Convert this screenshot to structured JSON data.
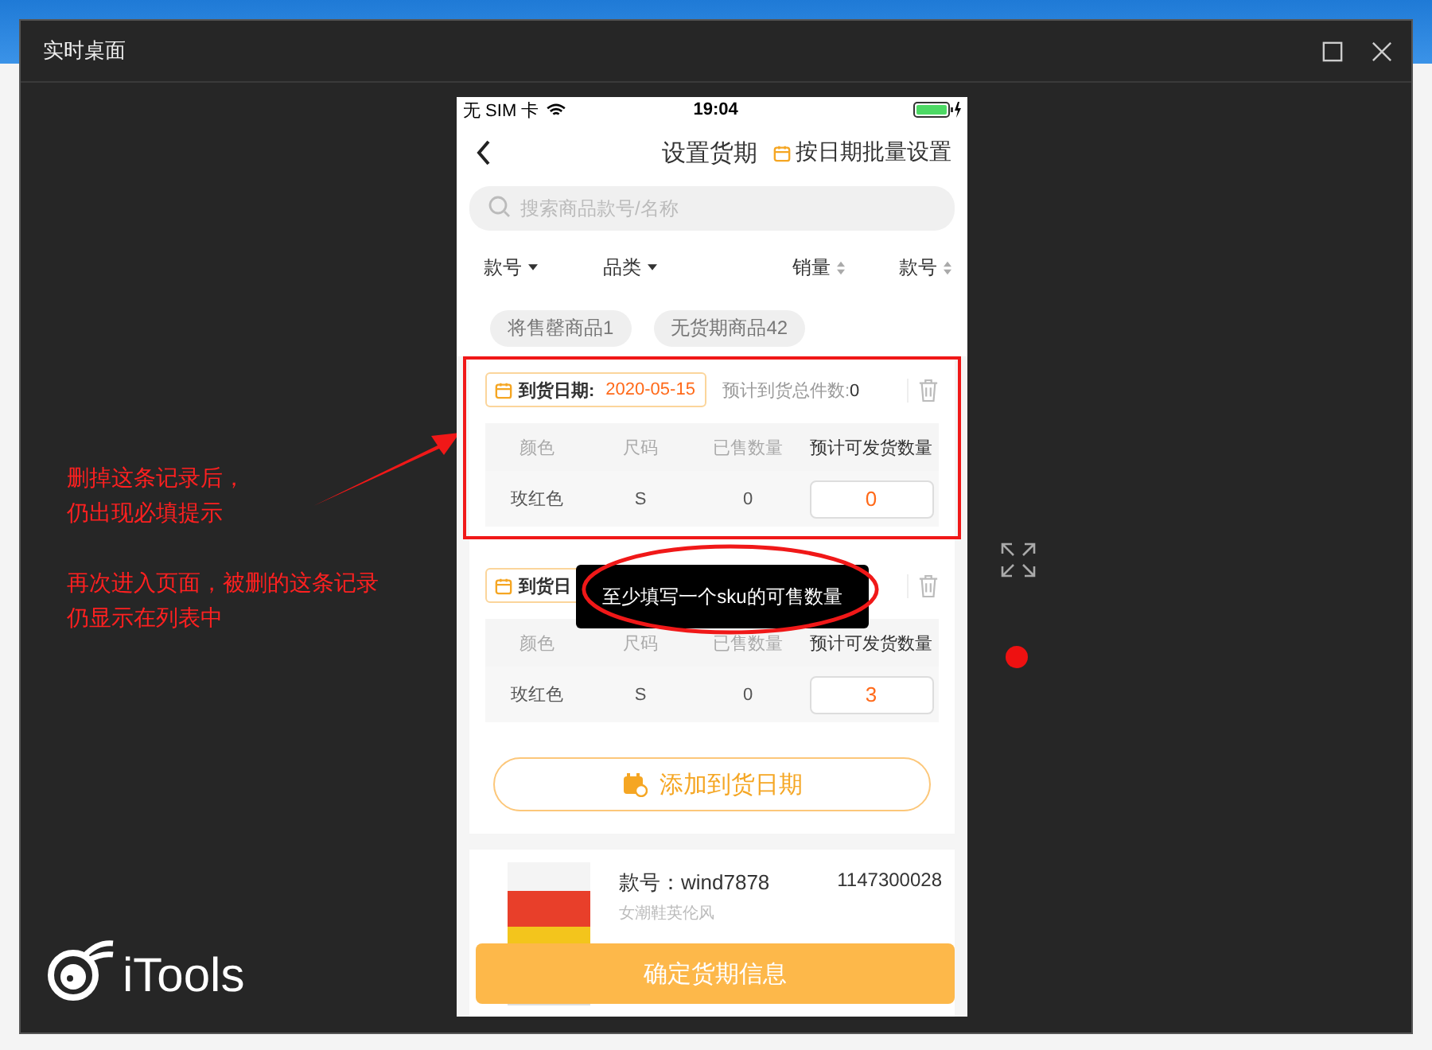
{
  "window": {
    "title": "实时桌面"
  },
  "phone": {
    "status": {
      "carrier": "无 SIM 卡",
      "time": "19:04"
    },
    "nav": {
      "title": "设置货期",
      "action": "按日期批量设置"
    },
    "search": {
      "placeholder": "搜索商品款号/名称"
    },
    "sort": [
      {
        "label": "款号",
        "kind": "dropdown"
      },
      {
        "label": "品类",
        "kind": "dropdown"
      },
      {
        "label": "销量",
        "kind": "sort"
      },
      {
        "label": "款号",
        "kind": "sort"
      }
    ],
    "chips": [
      "将售罄商品1",
      "无货期商品42"
    ],
    "batches": [
      {
        "highlighted": true,
        "date_label": "到货日期:",
        "date": "2020-05-15",
        "total_label": "预计到货总件数:",
        "total": "0",
        "headers": [
          "颜色",
          "尺码",
          "已售数量",
          "预计可发货数量"
        ],
        "rows": [
          {
            "variant": "玫红色",
            "size": "S",
            "sold": "0",
            "qty": "0"
          }
        ]
      },
      {
        "highlighted": false,
        "date_label": "到货日",
        "headers": [
          "颜色",
          "尺码",
          "已售数量",
          "预计可发货数量"
        ],
        "rows": [
          {
            "variant": "玫红色",
            "size": "S",
            "sold": "0",
            "qty": "3"
          }
        ]
      }
    ],
    "add_button": "添加到货日期",
    "toast": "至少填写一个sku的可售数量",
    "product": {
      "code": "款号：wind7878",
      "id": "1147300028",
      "name": "女潮鞋英伦风"
    },
    "confirm_button": "确定货期信息"
  },
  "annotations": [
    "删掉这条记录后，仍出现必填提示",
    "再次进入页面，被删的这条记录仍显示在列表中"
  ],
  "brand": "iTools"
}
